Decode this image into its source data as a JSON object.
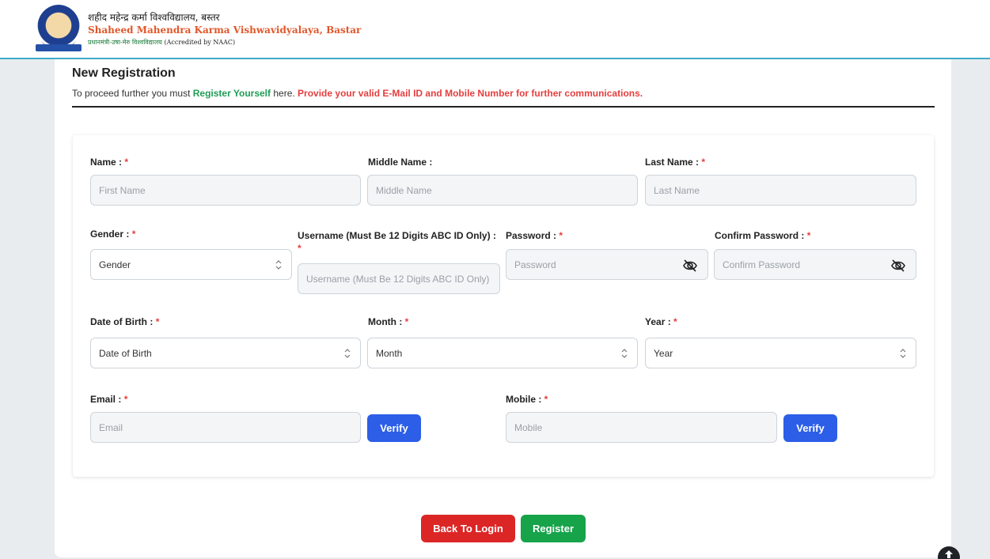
{
  "header": {
    "hindi_name": "शहीद महेन्द्र कर्मा विश्वविद्यालय, बस्तर",
    "english_name": "Shaheed Mahendra Karma Vishwavidyalaya, Bastar",
    "sub_hindi": "प्रधानमंत्री-उषा-मेरु विश्वविद्यालय",
    "sub_naac": "(Accredited by NAAC)"
  },
  "page": {
    "title": "New Registration",
    "intro_prefix": "To proceed further you must ",
    "intro_highlight": "Register Yourself",
    "intro_middle": " here. ",
    "intro_warning": "Provide your valid E-Mail ID and Mobile Number for further communications."
  },
  "form": {
    "required_mark": "*",
    "name": {
      "label": "Name :",
      "placeholder": "First Name"
    },
    "middle_name": {
      "label": "Middle Name :",
      "placeholder": "Middle Name"
    },
    "last_name": {
      "label": "Last Name :",
      "placeholder": "Last Name"
    },
    "gender": {
      "label": "Gender :",
      "value": "Gender"
    },
    "username": {
      "label": "Username (Must Be 12 Digits ABC ID Only) :",
      "placeholder": "Username (Must Be 12 Digits ABC ID Only)"
    },
    "password": {
      "label": "Password :",
      "placeholder": "Password"
    },
    "confirm_password": {
      "label": "Confirm Password :",
      "placeholder": "Confirm Password"
    },
    "dob": {
      "label": "Date of Birth :",
      "value": "Date of Birth"
    },
    "month": {
      "label": "Month :",
      "value": "Month"
    },
    "year": {
      "label": "Year :",
      "value": "Year"
    },
    "email": {
      "label": "Email :",
      "placeholder": "Email",
      "verify_label": "Verify"
    },
    "mobile": {
      "label": "Mobile :",
      "placeholder": "Mobile",
      "verify_label": "Verify"
    }
  },
  "actions": {
    "back_label": "Back To Login",
    "register_label": "Register"
  },
  "colors": {
    "accent_blue": "#2c5ee8",
    "danger_red": "#dc2626",
    "success_green": "#16a34a",
    "required_red": "#e53e3e",
    "header_line": "#3fa9c7"
  }
}
